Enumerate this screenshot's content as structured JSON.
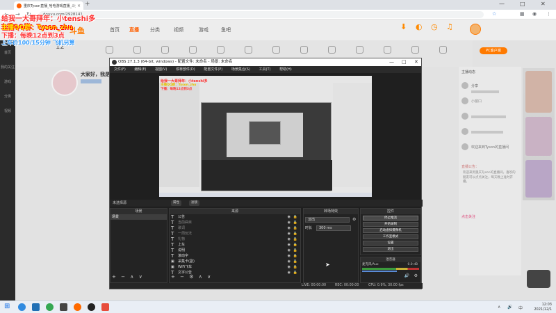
{
  "browser": {
    "tab_title": "重庆Tyson直播_哈哈游戏直播_斗鱼",
    "tab_close": "×",
    "new_tab": "+",
    "url": "douyu.com/2928141",
    "nav": {
      "back": "←",
      "forward": "→",
      "reload": "↻"
    },
    "window": {
      "minimize": "—",
      "maximize": "□",
      "close": "✕"
    },
    "icons": {
      "star": "☆",
      "menu": "⋮"
    }
  },
  "site": {
    "logo": "斗鱼",
    "nav": [
      "首页",
      "直播",
      "分类",
      "视频",
      "游戏",
      "鱼吧"
    ],
    "active_nav": "直播",
    "follow_count": "12",
    "pc_button": "PC客户端",
    "streamer_greeting": "大家好，我是",
    "sidebar": [
      "首页",
      "我的关注",
      "游戏",
      "分类",
      "视频"
    ],
    "right_panel": {
      "title": "主播动态",
      "lines": [
        "分享",
        "小窗口",
        "欢迎来到Tyson的直播间"
      ],
      "notice_title": "直播公告：",
      "notice_text": "欢迎来到重庆Tyson的直播间，喜欢的朋友可以点点关注，每天晚上准时开播。",
      "link": "点击关注"
    }
  },
  "overlay": {
    "line1": "给我一大哥拜年：小tenshi多",
    "line2": "主播QQ群：Tyson_zhu",
    "line3": "下播：每晚12点到3点",
    "line4": "上车价100/15分钟 飞机另算"
  },
  "obs": {
    "title": "OBS 27.1.3 (64-bit, windows) - 配置文件: 未命名 - 场景: 未命名",
    "menu": [
      "文件(F)",
      "编辑(E)",
      "视图(V)",
      "停靠部件(D)",
      "配置文件(P)",
      "场景集合(S)",
      "工具(T)",
      "帮助(H)"
    ],
    "scene_toolbar": {
      "label": "未选择源",
      "props": "属性",
      "filters": "滤镜"
    },
    "docks": {
      "scenes": "场景",
      "sources": "来源",
      "transitions": "转场特效",
      "controls": "控件",
      "mixer": "混音器"
    },
    "scenes": [
      "场景"
    ],
    "sources": [
      {
        "name": "公告",
        "type": "text",
        "dim": false
      },
      {
        "name": "当前曲目",
        "type": "text",
        "dim": true
      },
      {
        "name": "歌词",
        "type": "text",
        "dim": true
      },
      {
        "name": "一周玩法",
        "type": "text",
        "dim": true
      },
      {
        "name": "礼物",
        "type": "text",
        "dim": true
      },
      {
        "name": "上车",
        "type": "text",
        "dim": false
      },
      {
        "name": "说明",
        "type": "text",
        "dim": false
      },
      {
        "name": "滚动字",
        "type": "text",
        "dim": false
      },
      {
        "name": "采集卡(副)",
        "type": "capture",
        "dim": false
      },
      {
        "name": "WiFi飞车",
        "type": "capture",
        "dim": false
      },
      {
        "name": "文字公告",
        "type": "text",
        "dim": false
      }
    ],
    "transition": {
      "type": "淡出",
      "duration_label": "时长",
      "duration": "300 ms"
    },
    "controls": [
      "停止推流",
      "开始录制",
      "启动虚拟摄像机",
      "工作室模式",
      "设置",
      "退出"
    ],
    "active_control": "停止推流",
    "mixer": {
      "channel": "麦克风/Aux",
      "level": "0.0 dB"
    },
    "status": {
      "live": "LIVE: 00:00:00",
      "rec": "REC: 00:00:00",
      "cpu": "CPU: 0.9%, 30.00 fps"
    },
    "foot_buttons": [
      "+",
      "−",
      "∧",
      "∨"
    ],
    "source_foot_buttons": [
      "+",
      "−",
      "⚙",
      "∧",
      "∨"
    ]
  },
  "taskbar": {
    "time": "12:03",
    "date": "2021/12/1",
    "tray": [
      "∧",
      "🔊",
      "中"
    ]
  },
  "colors": {
    "accent": "#ff7a00",
    "overlay_red": "#ff2e2e",
    "overlay_yellow": "#ffe600",
    "overlay_blue": "#3aa0ff"
  }
}
